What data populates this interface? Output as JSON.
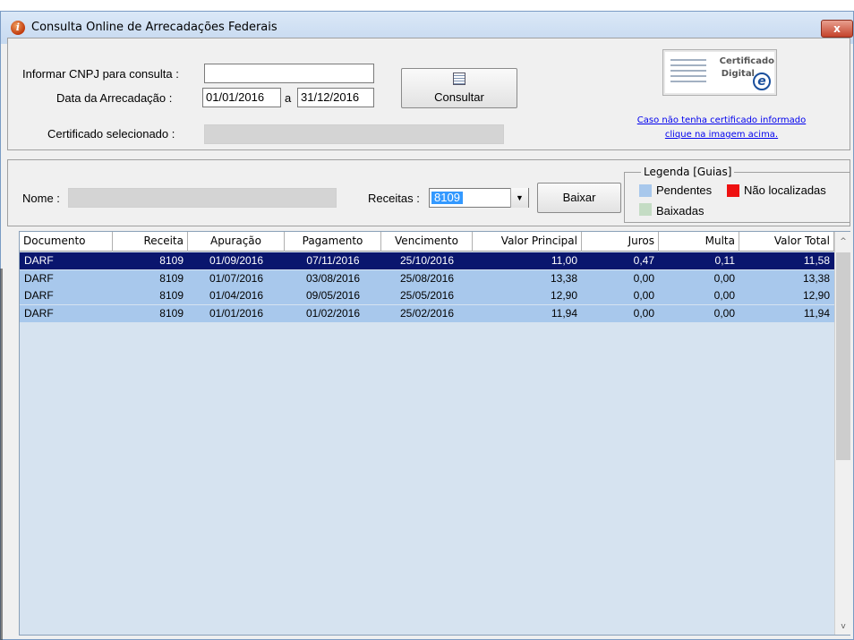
{
  "window": {
    "title": "Consulta Online de Arrecadações Federais",
    "close_label": "x"
  },
  "form": {
    "cnpj_label": "Informar CNPJ para consulta :",
    "cnpj_value": "",
    "data_label": "Data da Arrecadação :",
    "data_inicio": "01/01/2016",
    "a_label": "a",
    "data_fim": "31/12/2016",
    "consultar_label": "Consultar",
    "certificado_label": "Certificado selecionado :",
    "certificado_value": ""
  },
  "certificate": {
    "line1": "Certificado",
    "line2": "Digital",
    "link_line1": "Caso não tenha certificado informado",
    "link_line2": "clique na imagem acima."
  },
  "filters": {
    "nome_label": "Nome :",
    "nome_value": "",
    "receitas_label": "Receitas :",
    "receitas_value": "8109",
    "baixar_label": "Baixar"
  },
  "legend": {
    "title": "Legenda [Guias]",
    "items": [
      {
        "label": "Pendentes",
        "color": "#a8c8ec"
      },
      {
        "label": "Não localizadas",
        "color": "#ee1111"
      },
      {
        "label": "Baixadas",
        "color": "#c4dcc4"
      }
    ]
  },
  "table": {
    "columns": [
      "Documento",
      "Receita",
      "Apuração",
      "Pagamento",
      "Vencimento",
      "Valor Principal",
      "Juros",
      "Multa",
      "Valor Total"
    ],
    "rows": [
      [
        "DARF",
        "8109",
        "01/09/2016",
        "07/11/2016",
        "25/10/2016",
        "11,00",
        "0,47",
        "0,11",
        "11,58"
      ],
      [
        "DARF",
        "8109",
        "01/07/2016",
        "03/08/2016",
        "25/08/2016",
        "13,38",
        "0,00",
        "0,00",
        "13,38"
      ],
      [
        "DARF",
        "8109",
        "01/04/2016",
        "09/05/2016",
        "25/05/2016",
        "12,90",
        "0,00",
        "0,00",
        "12,90"
      ],
      [
        "DARF",
        "8109",
        "01/01/2016",
        "01/02/2016",
        "25/02/2016",
        "11,94",
        "0,00",
        "0,00",
        "11,94"
      ]
    ],
    "selected_row": 0
  },
  "colors": {
    "selected_row": "#0a166e",
    "pending_row": "#a8c8ec",
    "grid_bg": "#d6e3f0"
  }
}
